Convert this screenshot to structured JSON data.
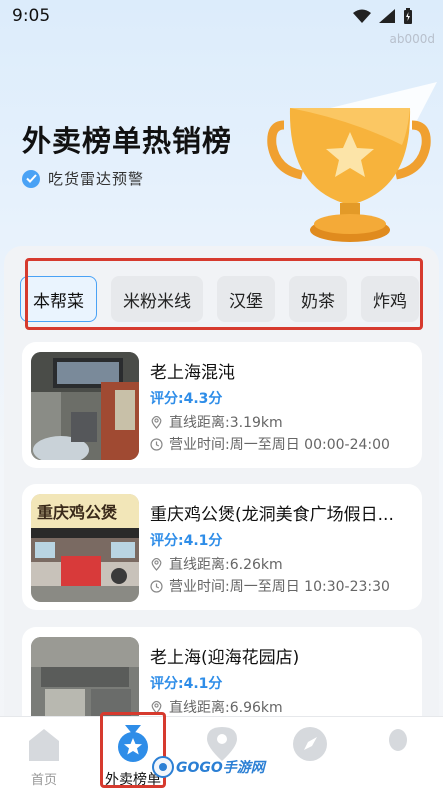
{
  "status_bar": {
    "time": "9:05",
    "device_id": "ab000d"
  },
  "hero": {
    "title": "外卖榜单热销榜",
    "subtitle": "吃货雷达预警"
  },
  "tabs": [
    {
      "label": "本帮菜",
      "active": true
    },
    {
      "label": "米粉米线",
      "active": false
    },
    {
      "label": "汉堡",
      "active": false
    },
    {
      "label": "奶茶",
      "active": false
    },
    {
      "label": "炸鸡",
      "active": false
    }
  ],
  "restaurants": [
    {
      "name": "老上海混沌",
      "rating": "评分:4.3分",
      "distance": "直线距离:3.19km",
      "hours": "营业时间:周一至周日 00:00-24:00"
    },
    {
      "name": "重庆鸡公煲(龙洞美食广场假日...",
      "rating": "评分:4.1分",
      "distance": "直线距离:6.26km",
      "hours": "营业时间:周一至周日 10:30-23:30",
      "sign_text": "重庆鸡公煲"
    },
    {
      "name": "老上海(迎海花园店)",
      "rating": "评分:4.1分",
      "distance": "直线距离:6.96km",
      "hours": ""
    }
  ],
  "bottom_nav": [
    {
      "label": "首页",
      "icon": "home-icon",
      "active": false
    },
    {
      "label": "外卖榜单",
      "icon": "medal-icon",
      "active": true
    },
    {
      "label": "",
      "icon": "location-icon",
      "active": false
    },
    {
      "label": "",
      "icon": "compass-icon",
      "active": false
    },
    {
      "label": "",
      "icon": "user-icon",
      "active": false
    }
  ],
  "watermark": {
    "text": "GOGO手游网"
  },
  "colors": {
    "accent": "#2e8de8",
    "highlight_box": "#d63a2e",
    "trophy": "#f5a623"
  }
}
